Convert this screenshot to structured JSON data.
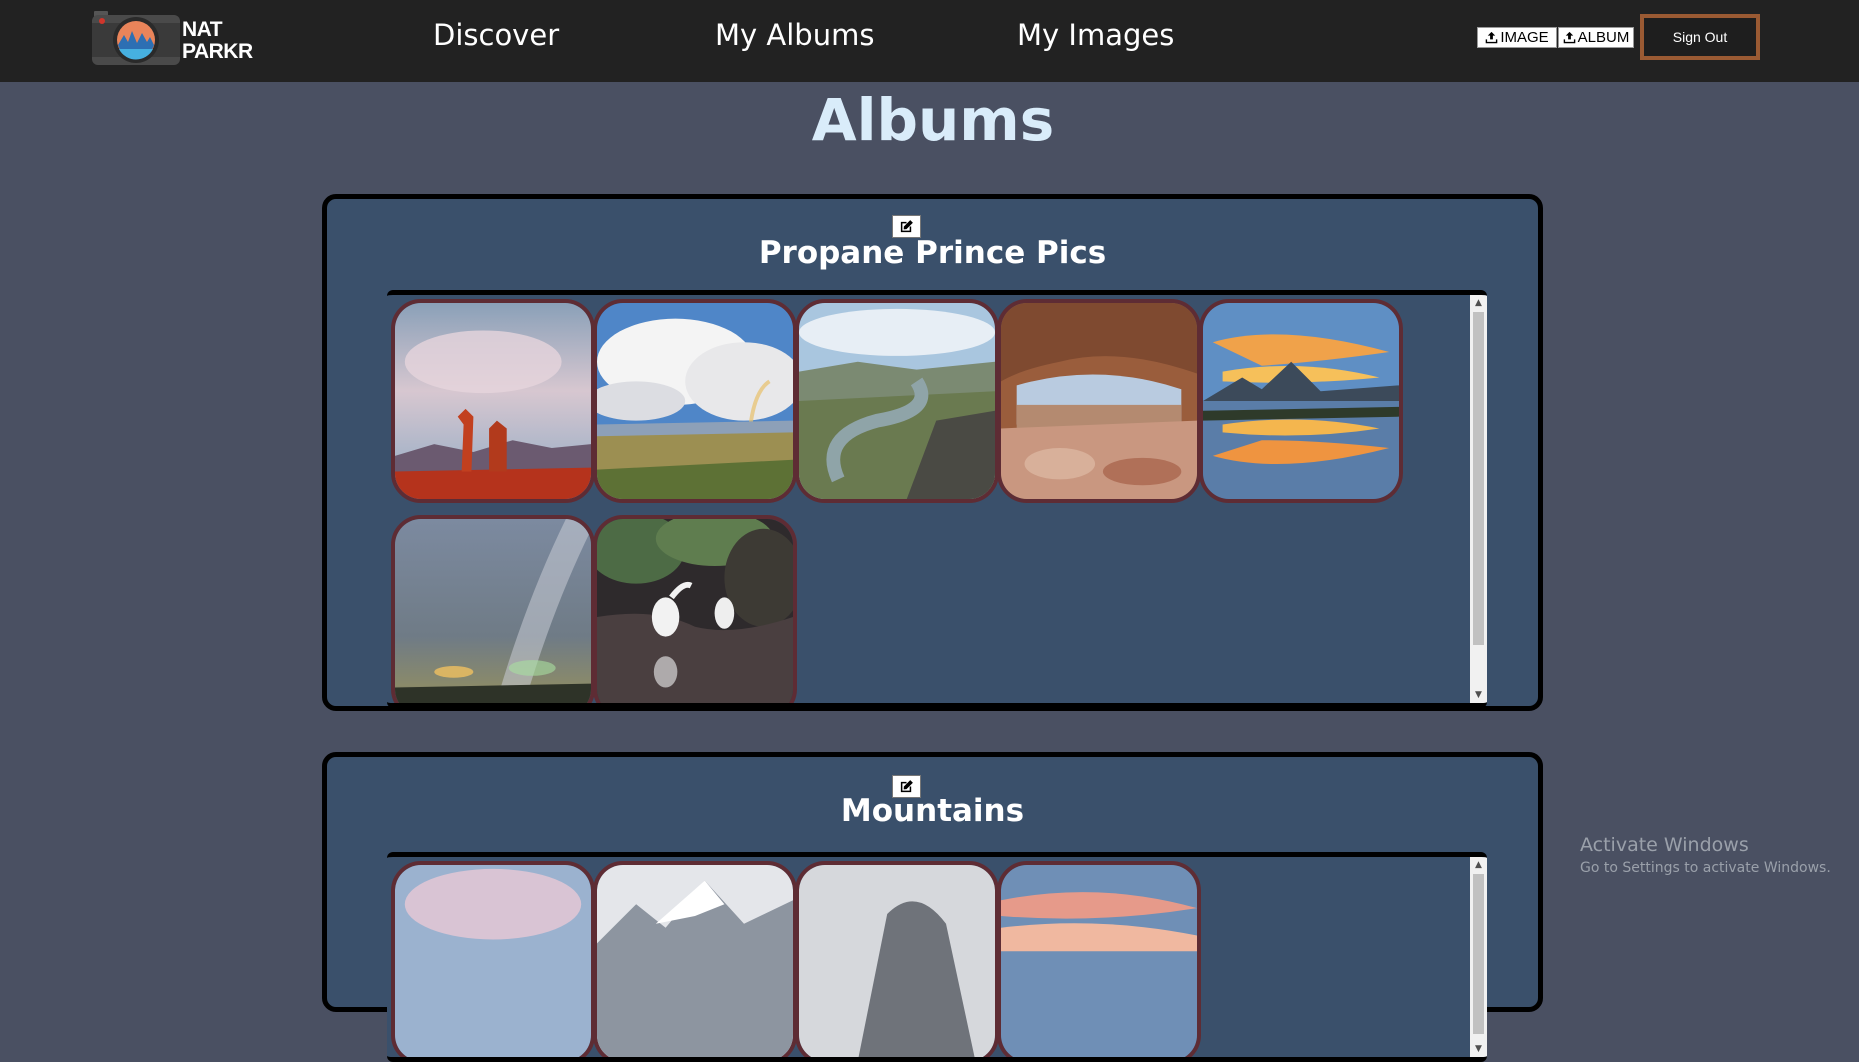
{
  "header": {
    "logo": {
      "line1": "NAT",
      "line2": "PARKR"
    },
    "nav": {
      "discover": "Discover",
      "my_albums": "My Albums",
      "my_images": "My Images"
    },
    "upload_image_label": "IMAGE",
    "upload_album_label": "ALBUM",
    "upload_icon": "upload-icon",
    "sign_out_label": "Sign Out"
  },
  "page": {
    "title": "Albums"
  },
  "albums": [
    {
      "title": "Propane Prince Pics",
      "edit_icon": "edit-icon",
      "photos": [
        "balanced-rock-sunset",
        "rainbow-over-valley",
        "river-canyon",
        "mesa-arch-overlook",
        "mountain-lake-sunset-reflection",
        "milky-way-night-sky",
        "egrets-in-swamp"
      ]
    },
    {
      "title": "Mountains",
      "edit_icon": "edit-icon",
      "photos": [
        "red-rock-sunset",
        "snowy-mountain-peaks",
        "misty-granite-dome",
        "pink-sunset-clouds"
      ]
    }
  ],
  "watermark": {
    "title": "Activate Windows",
    "subtitle": "Go to Settings to activate Windows."
  },
  "colors": {
    "page_bg": "#4a5062",
    "navbar_bg": "#222222",
    "title_color": "#d9ecfa",
    "album_bg": "#3a506b",
    "thumb_border": "#5e2c34",
    "signout_border": "#9a5a33"
  }
}
